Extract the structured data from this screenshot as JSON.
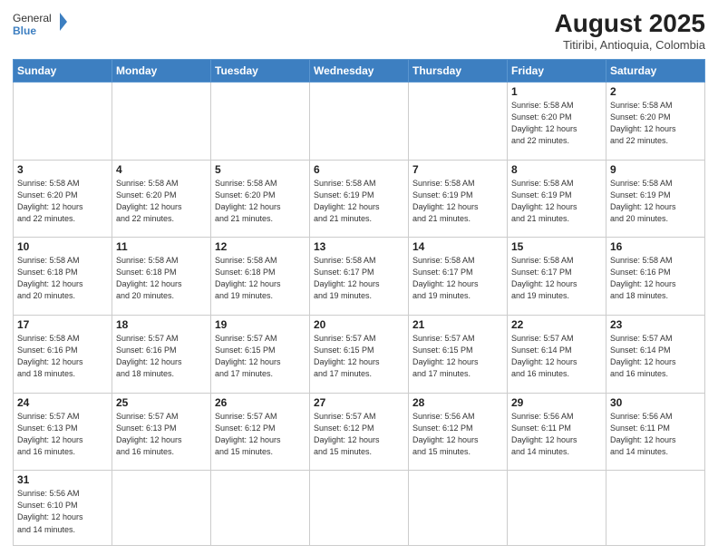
{
  "header": {
    "logo_general": "General",
    "logo_blue": "Blue",
    "month_year": "August 2025",
    "location": "Titiribi, Antioquia, Colombia"
  },
  "weekdays": [
    "Sunday",
    "Monday",
    "Tuesday",
    "Wednesday",
    "Thursday",
    "Friday",
    "Saturday"
  ],
  "weeks": [
    [
      {
        "day": "",
        "info": ""
      },
      {
        "day": "",
        "info": ""
      },
      {
        "day": "",
        "info": ""
      },
      {
        "day": "",
        "info": ""
      },
      {
        "day": "",
        "info": ""
      },
      {
        "day": "1",
        "info": "Sunrise: 5:58 AM\nSunset: 6:20 PM\nDaylight: 12 hours\nand 22 minutes."
      },
      {
        "day": "2",
        "info": "Sunrise: 5:58 AM\nSunset: 6:20 PM\nDaylight: 12 hours\nand 22 minutes."
      }
    ],
    [
      {
        "day": "3",
        "info": "Sunrise: 5:58 AM\nSunset: 6:20 PM\nDaylight: 12 hours\nand 22 minutes."
      },
      {
        "day": "4",
        "info": "Sunrise: 5:58 AM\nSunset: 6:20 PM\nDaylight: 12 hours\nand 22 minutes."
      },
      {
        "day": "5",
        "info": "Sunrise: 5:58 AM\nSunset: 6:20 PM\nDaylight: 12 hours\nand 21 minutes."
      },
      {
        "day": "6",
        "info": "Sunrise: 5:58 AM\nSunset: 6:19 PM\nDaylight: 12 hours\nand 21 minutes."
      },
      {
        "day": "7",
        "info": "Sunrise: 5:58 AM\nSunset: 6:19 PM\nDaylight: 12 hours\nand 21 minutes."
      },
      {
        "day": "8",
        "info": "Sunrise: 5:58 AM\nSunset: 6:19 PM\nDaylight: 12 hours\nand 21 minutes."
      },
      {
        "day": "9",
        "info": "Sunrise: 5:58 AM\nSunset: 6:19 PM\nDaylight: 12 hours\nand 20 minutes."
      }
    ],
    [
      {
        "day": "10",
        "info": "Sunrise: 5:58 AM\nSunset: 6:18 PM\nDaylight: 12 hours\nand 20 minutes."
      },
      {
        "day": "11",
        "info": "Sunrise: 5:58 AM\nSunset: 6:18 PM\nDaylight: 12 hours\nand 20 minutes."
      },
      {
        "day": "12",
        "info": "Sunrise: 5:58 AM\nSunset: 6:18 PM\nDaylight: 12 hours\nand 19 minutes."
      },
      {
        "day": "13",
        "info": "Sunrise: 5:58 AM\nSunset: 6:17 PM\nDaylight: 12 hours\nand 19 minutes."
      },
      {
        "day": "14",
        "info": "Sunrise: 5:58 AM\nSunset: 6:17 PM\nDaylight: 12 hours\nand 19 minutes."
      },
      {
        "day": "15",
        "info": "Sunrise: 5:58 AM\nSunset: 6:17 PM\nDaylight: 12 hours\nand 19 minutes."
      },
      {
        "day": "16",
        "info": "Sunrise: 5:58 AM\nSunset: 6:16 PM\nDaylight: 12 hours\nand 18 minutes."
      }
    ],
    [
      {
        "day": "17",
        "info": "Sunrise: 5:58 AM\nSunset: 6:16 PM\nDaylight: 12 hours\nand 18 minutes."
      },
      {
        "day": "18",
        "info": "Sunrise: 5:57 AM\nSunset: 6:16 PM\nDaylight: 12 hours\nand 18 minutes."
      },
      {
        "day": "19",
        "info": "Sunrise: 5:57 AM\nSunset: 6:15 PM\nDaylight: 12 hours\nand 17 minutes."
      },
      {
        "day": "20",
        "info": "Sunrise: 5:57 AM\nSunset: 6:15 PM\nDaylight: 12 hours\nand 17 minutes."
      },
      {
        "day": "21",
        "info": "Sunrise: 5:57 AM\nSunset: 6:15 PM\nDaylight: 12 hours\nand 17 minutes."
      },
      {
        "day": "22",
        "info": "Sunrise: 5:57 AM\nSunset: 6:14 PM\nDaylight: 12 hours\nand 16 minutes."
      },
      {
        "day": "23",
        "info": "Sunrise: 5:57 AM\nSunset: 6:14 PM\nDaylight: 12 hours\nand 16 minutes."
      }
    ],
    [
      {
        "day": "24",
        "info": "Sunrise: 5:57 AM\nSunset: 6:13 PM\nDaylight: 12 hours\nand 16 minutes."
      },
      {
        "day": "25",
        "info": "Sunrise: 5:57 AM\nSunset: 6:13 PM\nDaylight: 12 hours\nand 16 minutes."
      },
      {
        "day": "26",
        "info": "Sunrise: 5:57 AM\nSunset: 6:12 PM\nDaylight: 12 hours\nand 15 minutes."
      },
      {
        "day": "27",
        "info": "Sunrise: 5:57 AM\nSunset: 6:12 PM\nDaylight: 12 hours\nand 15 minutes."
      },
      {
        "day": "28",
        "info": "Sunrise: 5:56 AM\nSunset: 6:12 PM\nDaylight: 12 hours\nand 15 minutes."
      },
      {
        "day": "29",
        "info": "Sunrise: 5:56 AM\nSunset: 6:11 PM\nDaylight: 12 hours\nand 14 minutes."
      },
      {
        "day": "30",
        "info": "Sunrise: 5:56 AM\nSunset: 6:11 PM\nDaylight: 12 hours\nand 14 minutes."
      }
    ],
    [
      {
        "day": "31",
        "info": "Sunrise: 5:56 AM\nSunset: 6:10 PM\nDaylight: 12 hours\nand 14 minutes."
      },
      {
        "day": "",
        "info": ""
      },
      {
        "day": "",
        "info": ""
      },
      {
        "day": "",
        "info": ""
      },
      {
        "day": "",
        "info": ""
      },
      {
        "day": "",
        "info": ""
      },
      {
        "day": "",
        "info": ""
      }
    ]
  ]
}
